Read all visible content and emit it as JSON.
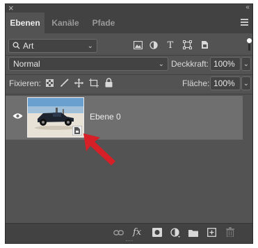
{
  "tabs": [
    {
      "label": "Ebenen",
      "active": true
    },
    {
      "label": "Kanäle",
      "active": false
    },
    {
      "label": "Pfade",
      "active": false
    }
  ],
  "filter": {
    "value": "Art"
  },
  "blend": {
    "mode": "Normal"
  },
  "opacity": {
    "label": "Deckkraft:",
    "value": "100%"
  },
  "lock": {
    "label": "Fixieren:"
  },
  "fill": {
    "label": "Fläche:",
    "value": "100%"
  },
  "layers": [
    {
      "name": "Ebene 0",
      "visible": true,
      "smart_object": true
    }
  ],
  "bottom_bar": {
    "fx_label": "fx"
  },
  "colors": {
    "panel": "#535353",
    "selected_row": "#6f6f6f",
    "annotation_arrow": "#d61f26"
  }
}
